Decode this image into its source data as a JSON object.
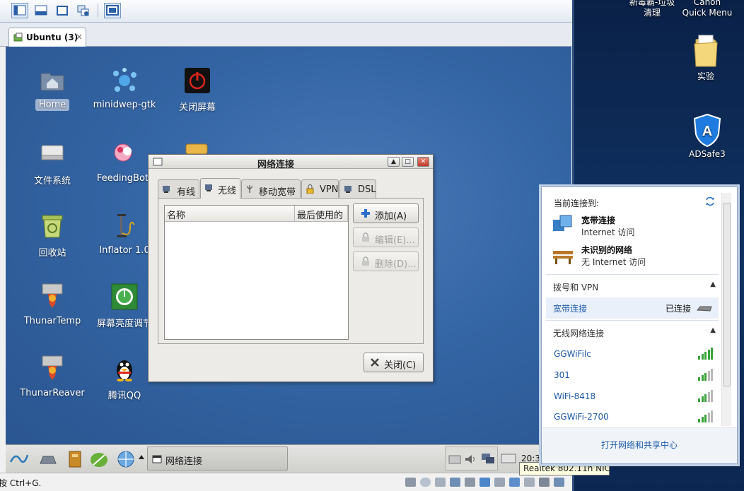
{
  "host": {
    "top_labels": [
      "新毒霸-垃圾\n清理",
      "Canon\nQuick Menu"
    ],
    "icons": [
      {
        "label": "实验",
        "icon": "folder-icon"
      },
      {
        "label": "ADSafe3",
        "icon": "adsafe-shield-icon"
      }
    ]
  },
  "vm": {
    "tab_title": "Ubuntu (3)",
    "tab_close": "×",
    "status_text": "按 Ctrl+G.",
    "tooltip": "Realtek 802.11n NIC"
  },
  "desktop": {
    "icons": [
      {
        "label": "Home",
        "icon": "home-folder-icon"
      },
      {
        "label": "minidwep-gtk",
        "icon": "minidwep-splash-icon"
      },
      {
        "label": "关闭屏幕",
        "icon": "power-icon"
      },
      {
        "label": "文件系统",
        "icon": "drive-icon"
      },
      {
        "label": "FeedingBott",
        "icon": "feeding-bottle-icon"
      },
      {
        "label": "回收站",
        "icon": "trash-icon"
      },
      {
        "label": "Inflator 1.0",
        "icon": "inflator-pump-icon"
      },
      {
        "label": "ThunarTemp",
        "icon": "thunar-temp-icon"
      },
      {
        "label": "屏幕亮度调节",
        "icon": "brightness-icon"
      },
      {
        "label": "ThunarReaver",
        "icon": "thunar-reaver-icon"
      },
      {
        "label": "腾讯QQ",
        "icon": "qq-penguin-icon"
      }
    ]
  },
  "dialog": {
    "title": "网络连接",
    "tabs": [
      {
        "label": "有线",
        "icon": "wired-icon"
      },
      {
        "label": "无线",
        "icon": "wireless-icon"
      },
      {
        "label": "移动宽带",
        "icon": "mobile-broadband-icon"
      },
      {
        "label": "VPN",
        "icon": "vpn-lock-icon"
      },
      {
        "label": "DSL",
        "icon": "dsl-icon"
      }
    ],
    "active_tab": "无线",
    "columns": [
      "名称",
      "最后使用的"
    ],
    "buttons": {
      "add": "添加(A)",
      "edit": "编辑(E)...",
      "delete": "删除(D)...",
      "close": "关闭(C)"
    },
    "window_buttons": [
      "▲",
      "□",
      "✕"
    ]
  },
  "taskbar": {
    "task_label": "网络连接",
    "clock": "20:3"
  },
  "flyout": {
    "header": "当前连接到:",
    "connections": [
      {
        "name": "宽带连接",
        "status": "Internet 访问",
        "icon": "broadband-network-icon"
      },
      {
        "name": "未识别的网络",
        "status": "无 Internet 访问",
        "icon": "public-network-bench-icon"
      }
    ],
    "dialup_section": "拨号和 VPN",
    "dialup_item": {
      "name": "宽带连接",
      "status": "已连接"
    },
    "wireless_section": "无线网络连接",
    "networks": [
      {
        "name": "GGWiFilc",
        "signal": 5
      },
      {
        "name": "301",
        "signal": 3
      },
      {
        "name": "WiFi-8418",
        "signal": 3
      },
      {
        "name": "GGWiFi-2700",
        "signal": 3
      }
    ],
    "footer_link": "打开网络和共享中心"
  },
  "colors": {
    "guest_desktop": "#3465a4",
    "link_blue": "#1e5aa8",
    "signal_green": "#3aa33a"
  }
}
